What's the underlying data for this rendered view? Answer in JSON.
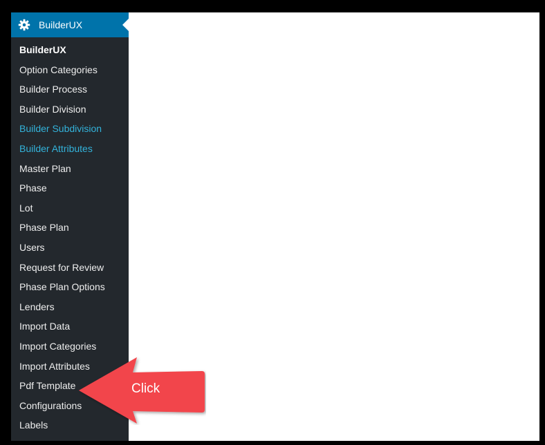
{
  "sidebar": {
    "header": {
      "title": "BuilderUX",
      "icon": "gear-icon"
    },
    "items": [
      {
        "label": "BuilderUX",
        "state": "current"
      },
      {
        "label": "Option Categories",
        "state": "normal"
      },
      {
        "label": "Builder Process",
        "state": "normal"
      },
      {
        "label": "Builder Division",
        "state": "normal"
      },
      {
        "label": "Builder Subdivision",
        "state": "hover"
      },
      {
        "label": "Builder Attributes",
        "state": "hover"
      },
      {
        "label": "Master Plan",
        "state": "normal"
      },
      {
        "label": "Phase",
        "state": "normal"
      },
      {
        "label": "Lot",
        "state": "normal"
      },
      {
        "label": "Phase Plan",
        "state": "normal"
      },
      {
        "label": "Users",
        "state": "normal"
      },
      {
        "label": "Request for Review",
        "state": "normal"
      },
      {
        "label": "Phase Plan Options",
        "state": "normal"
      },
      {
        "label": "Lenders",
        "state": "normal"
      },
      {
        "label": "Import Data",
        "state": "normal"
      },
      {
        "label": "Import Categories",
        "state": "normal"
      },
      {
        "label": "Import Attributes",
        "state": "normal"
      },
      {
        "label": "Pdf Template",
        "state": "normal"
      },
      {
        "label": "Configurations",
        "state": "normal"
      },
      {
        "label": "Labels",
        "state": "normal"
      }
    ]
  },
  "callout": {
    "label": "Click",
    "icon": "arrow-left-icon",
    "color": "#f2454c"
  },
  "colors": {
    "sidebar_bg": "#23282d",
    "header_bg": "#0073aa",
    "link_highlight": "#33b3db",
    "text": "#eeeeee"
  }
}
